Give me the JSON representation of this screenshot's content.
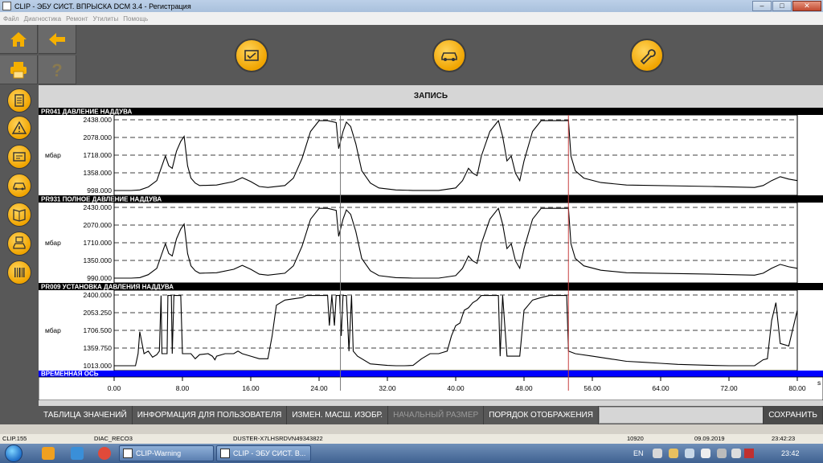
{
  "window": {
    "title": "CLIP - ЭБУ СИСТ. ВПРЫСКА DCM 3.4 - Регистрация",
    "buttons": {
      "minimize": "–",
      "maximize": "□",
      "close": "✕"
    }
  },
  "menu": [
    "Файл",
    "Диагностика",
    "Ремонт",
    "Утилиты",
    "Помощь"
  ],
  "toolbar": {
    "home_icon": "home-icon",
    "back_icon": "back-arrow-icon",
    "print_icon": "printer-icon",
    "help_icon": "question-icon",
    "actions": [
      "document-check-icon",
      "car-ecu-icon",
      "wrench-icon"
    ]
  },
  "sidebar": {
    "items": [
      "document-icon",
      "warning-icon",
      "screen-icon",
      "car-icon",
      "book-icon",
      "car-disk-icon",
      "barcode-icon"
    ]
  },
  "main": {
    "title": "ЗАПИСЬ"
  },
  "panels": [
    {
      "title": "PR041  ДАВЛЕНИЕ НАДДУВА",
      "unit": "мбар",
      "ticks": [
        "2438.000",
        "2078.000",
        "1718.000",
        "1358.000",
        "998.000"
      ],
      "ymin": 998,
      "ymax": 2438
    },
    {
      "title": "PR931  ПОЛНОЕ ДАВЛЕНИЕ НАДДУВА",
      "unit": "мбар",
      "ticks": [
        "2430.000",
        "2070.000",
        "1710.000",
        "1350.000",
        "990.000"
      ],
      "ymin": 990,
      "ymax": 2430
    },
    {
      "title": "PR009  УСТАНОВКА ДАВЛЕНИЯ НАДДУВА",
      "unit": "мбар",
      "ticks": [
        "2400.000",
        "2053.250",
        "1706.500",
        "1359.750",
        "1013.000"
      ],
      "ymin": 1013,
      "ymax": 2400
    }
  ],
  "time_axis": {
    "title": "ВРЕМЕННАЯ ОСЬ",
    "unit": "s",
    "ticks": [
      "0.00",
      "8.00",
      "16.00",
      "24.00",
      "32.00",
      "40.00",
      "48.00",
      "56.00",
      "64.00",
      "72.00",
      "80.00"
    ],
    "cursor_gray": 26.5,
    "cursor_red": 53.2
  },
  "bottom_buttons": {
    "values_table": "ТАБЛИЦА ЗНАЧЕНИЙ",
    "user_info": "ИНФОРМАЦИЯ ДЛЯ ПОЛЬЗОВАТЕЛЯ",
    "change_scale": "ИЗМЕН. МАСШ. ИЗОБР.",
    "initial_size": "НАЧАЛЬНЫЙ РАЗМЕР",
    "display_order": "ПОРЯДОК ОТОБРАЖЕНИЯ",
    "save": "СОХРАНИТЬ"
  },
  "status": {
    "clip": "CLIP.155",
    "diag": "DIAC_RECO3",
    "vehicle": "DUSTER-X7LHSRDVN49343822",
    "code": "10920",
    "date": "09.09.2019",
    "time": "23:42:23"
  },
  "taskbar": {
    "tasks": [
      "CLIP-Warning",
      "CLIP - ЭБУ СИСТ. В..."
    ],
    "lang": "EN",
    "clock": "23:42"
  },
  "colors": {
    "accent": "#f5b000",
    "dark_panel": "#585858",
    "time_axis_bar": "#0000ff",
    "red_cursor": "#c84040"
  },
  "chart_data": [
    {
      "type": "line",
      "title": "PR041  ДАВЛЕНИЕ НАДДУВА",
      "ylabel": "мбар",
      "ylim": [
        998,
        2438
      ],
      "xlim": [
        0,
        80
      ],
      "series": [
        {
          "x": [
            0,
            2,
            3,
            4,
            5,
            5.5,
            6,
            6.4,
            6.8,
            7.3,
            7.8,
            8.2,
            8.6,
            9,
            9.5,
            10,
            12,
            14,
            15,
            16,
            17,
            18,
            20,
            21,
            22,
            23,
            24,
            25,
            26,
            26.3,
            26.8,
            27.2,
            27.7,
            28.3,
            29,
            30,
            31,
            33,
            35,
            38,
            40,
            40.8,
            41.5,
            42,
            42.5,
            43,
            44,
            45,
            45.5,
            46,
            46.5,
            47,
            47.5,
            48,
            49,
            50,
            51,
            52,
            53.2,
            53.5,
            54,
            55,
            57,
            60,
            70,
            75,
            76,
            77,
            78,
            79,
            80
          ],
          "values": [
            998,
            998,
            1010,
            1070,
            1200,
            1450,
            1700,
            1500,
            1450,
            1800,
            2000,
            2100,
            1500,
            1250,
            1150,
            1100,
            1110,
            1180,
            1260,
            1180,
            1080,
            1060,
            1100,
            1250,
            1650,
            2200,
            2420,
            2420,
            2380,
            1850,
            2200,
            2390,
            2300,
            1950,
            1400,
            1150,
            1050,
            1010,
            1000,
            1000,
            1050,
            1200,
            1450,
            1350,
            1300,
            1700,
            2200,
            2420,
            2100,
            1600,
            1700,
            1350,
            1200,
            1600,
            2200,
            2420,
            2420,
            2420,
            2420,
            1700,
            1400,
            1250,
            1160,
            1110,
            1080,
            1060,
            1100,
            1200,
            1280,
            1230,
            1200
          ]
        }
      ]
    },
    {
      "type": "line",
      "title": "PR931  ПОЛНОЕ ДАВЛЕНИЕ НАДДУВА",
      "ylabel": "мбар",
      "ylim": [
        990,
        2430
      ],
      "xlim": [
        0,
        80
      ],
      "series": [
        {
          "x": [
            0,
            2,
            3,
            4,
            5,
            5.5,
            6,
            6.4,
            6.8,
            7.3,
            7.8,
            8.2,
            8.6,
            9,
            9.5,
            10,
            12,
            14,
            15,
            16,
            17,
            18,
            20,
            21,
            22,
            23,
            24,
            25,
            26,
            26.3,
            26.8,
            27.2,
            27.7,
            28.3,
            29,
            30,
            31,
            33,
            35,
            38,
            40,
            40.8,
            41.5,
            42,
            42.5,
            43,
            44,
            45,
            45.5,
            46,
            46.5,
            47,
            47.5,
            48,
            49,
            50,
            51,
            52,
            53.2,
            53.5,
            54,
            55,
            57,
            60,
            70,
            75,
            76,
            77,
            78,
            79,
            80
          ],
          "values": [
            990,
            990,
            1000,
            1060,
            1190,
            1440,
            1690,
            1490,
            1440,
            1790,
            1990,
            2090,
            1490,
            1240,
            1140,
            1090,
            1100,
            1170,
            1250,
            1170,
            1070,
            1050,
            1090,
            1240,
            1640,
            2190,
            2410,
            2410,
            2370,
            1840,
            2190,
            2380,
            2290,
            1940,
            1390,
            1140,
            1040,
            1000,
            990,
            990,
            1040,
            1190,
            1440,
            1340,
            1290,
            1690,
            2190,
            2410,
            2090,
            1590,
            1690,
            1340,
            1190,
            1590,
            2190,
            2410,
            2410,
            2410,
            2410,
            1690,
            1390,
            1240,
            1150,
            1100,
            1070,
            1050,
            1090,
            1190,
            1270,
            1220,
            1190
          ]
        }
      ]
    },
    {
      "type": "line",
      "title": "PR009  УСТАНОВКА ДАВЛЕНИЯ НАДДУВА",
      "ylabel": "мбар",
      "ylim": [
        1013,
        2400
      ],
      "xlim": [
        0,
        80
      ],
      "series": [
        {
          "x": [
            0,
            2.5,
            2.8,
            3,
            3.5,
            4,
            4.5,
            5,
            5.3,
            5.5,
            5.6,
            6.2,
            6.3,
            6.7,
            6.8,
            7,
            7.8,
            8,
            9,
            9.5,
            10,
            11,
            11.5,
            11.8,
            12,
            13,
            14,
            14.5,
            15,
            16,
            17,
            18,
            18.5,
            19,
            20,
            22,
            22.5,
            23,
            24,
            25,
            25.2,
            25.5,
            25.8,
            26,
            26.2,
            26.4,
            26.6,
            26.8,
            27.2,
            27.5,
            27.8,
            28,
            28.5,
            30,
            32,
            33,
            34,
            35,
            36,
            37,
            38,
            39,
            39.5,
            40,
            40.5,
            41,
            41.5,
            42,
            42.5,
            43,
            44,
            45,
            45.2,
            45.5,
            46,
            47,
            47.5,
            48,
            49,
            50,
            51,
            52,
            53,
            53.2,
            54,
            56,
            58,
            60,
            62,
            64,
            66,
            68,
            70,
            72,
            74,
            75,
            76,
            76.5,
            77,
            77.5,
            78,
            79,
            80
          ],
          "values": [
            1013,
            1013,
            1250,
            1680,
            1250,
            1300,
            1180,
            1230,
            1300,
            2390,
            1250,
            1250,
            2390,
            2390,
            1250,
            2390,
            2390,
            1250,
            1250,
            1150,
            1230,
            1250,
            1200,
            1130,
            1200,
            1250,
            1250,
            1300,
            1250,
            1200,
            1150,
            1150,
            1600,
            2200,
            2300,
            2350,
            2390,
            2390,
            2390,
            2390,
            1800,
            2390,
            1800,
            2390,
            2390,
            2390,
            1600,
            2390,
            2390,
            1300,
            2390,
            1300,
            1200,
            1050,
            1020,
            1013,
            1013,
            1020,
            1150,
            1250,
            1250,
            1300,
            1600,
            1800,
            1850,
            2100,
            2150,
            2250,
            2300,
            2390,
            2390,
            2390,
            1200,
            2390,
            1200,
            1200,
            1200,
            2100,
            2300,
            2350,
            2390,
            2390,
            2390,
            1300,
            1250,
            1200,
            1150,
            1100,
            1080,
            1060,
            1040,
            1030,
            1020,
            1013,
            1013,
            1013,
            1130,
            1150,
            1900,
            2250,
            1450,
            1400,
            2100
          ]
        }
      ]
    }
  ]
}
